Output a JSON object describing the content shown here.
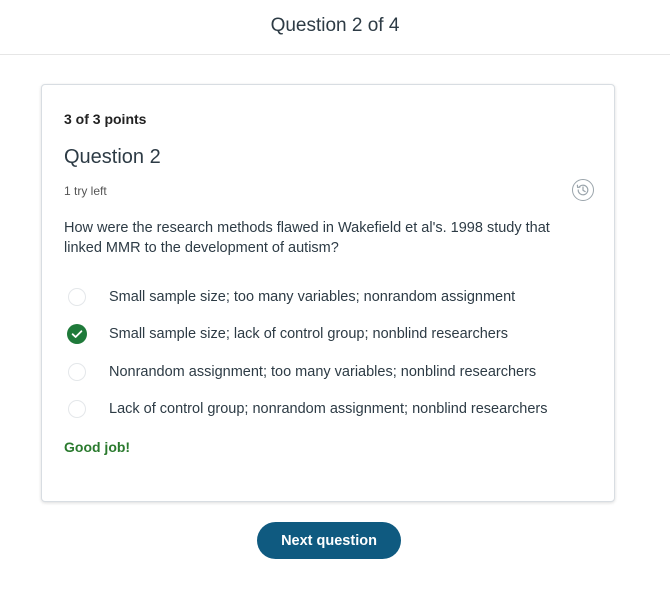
{
  "header": {
    "title": "Question 2 of 4"
  },
  "card": {
    "points": "3 of 3 points",
    "question_title": "Question 2",
    "tries_left": "1 try left",
    "history_icon": "history-icon",
    "prompt": "How were the research methods flawed in Wakefield et al's. 1998 study that linked MMR to the development of autism?",
    "options": [
      {
        "label": "Small sample size; too many variables; nonrandom assignment",
        "selected": false
      },
      {
        "label": "Small sample size; lack of control group; nonblind researchers",
        "selected": true
      },
      {
        "label": "Nonrandom assignment; too many variables; nonblind researchers",
        "selected": false
      },
      {
        "label": "Lack of control group; nonrandom assignment; nonblind researchers",
        "selected": false
      }
    ],
    "feedback": "Good job!"
  },
  "next_button": {
    "label": "Next question"
  },
  "colors": {
    "accent": "#0f5a80",
    "correct": "#1f7a3a",
    "feedback_text": "#2a7a2e"
  }
}
